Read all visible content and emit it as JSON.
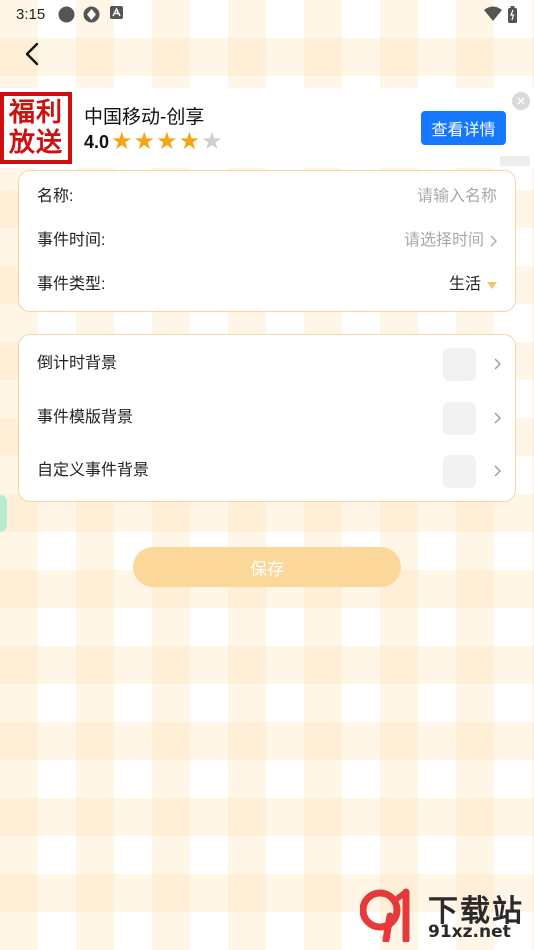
{
  "status_bar": {
    "time": "3:15",
    "icons": [
      "circle-dot-icon",
      "app-icon",
      "font-a-icon",
      "wifi-icon",
      "battery-icon"
    ]
  },
  "nav": {
    "back_icon": "chevron-left-icon"
  },
  "ad": {
    "thumb_text_line1": "福利",
    "thumb_text_line2": "放送",
    "title": "中国移动-创享",
    "rating": "4.0",
    "stars_filled": 4,
    "stars_total": 5,
    "button_label": "查看详情",
    "close_icon": "close-icon",
    "accent_color": "#1677ff",
    "star_color": "#f5a416"
  },
  "form": {
    "name": {
      "label": "名称:",
      "placeholder": "请输入名称"
    },
    "time": {
      "label": "事件时间:",
      "placeholder": "请选择时间"
    },
    "type": {
      "label": "事件类型:",
      "value": "生活"
    }
  },
  "backgrounds": {
    "items": [
      {
        "label": "倒计时背景"
      },
      {
        "label": "事件模版背景"
      },
      {
        "label": "自定义事件背景"
      }
    ]
  },
  "actions": {
    "save_label": "保存",
    "save_color": "#fbd79a"
  },
  "watermark": {
    "cn": "下载站",
    "url": "91xz.net"
  }
}
